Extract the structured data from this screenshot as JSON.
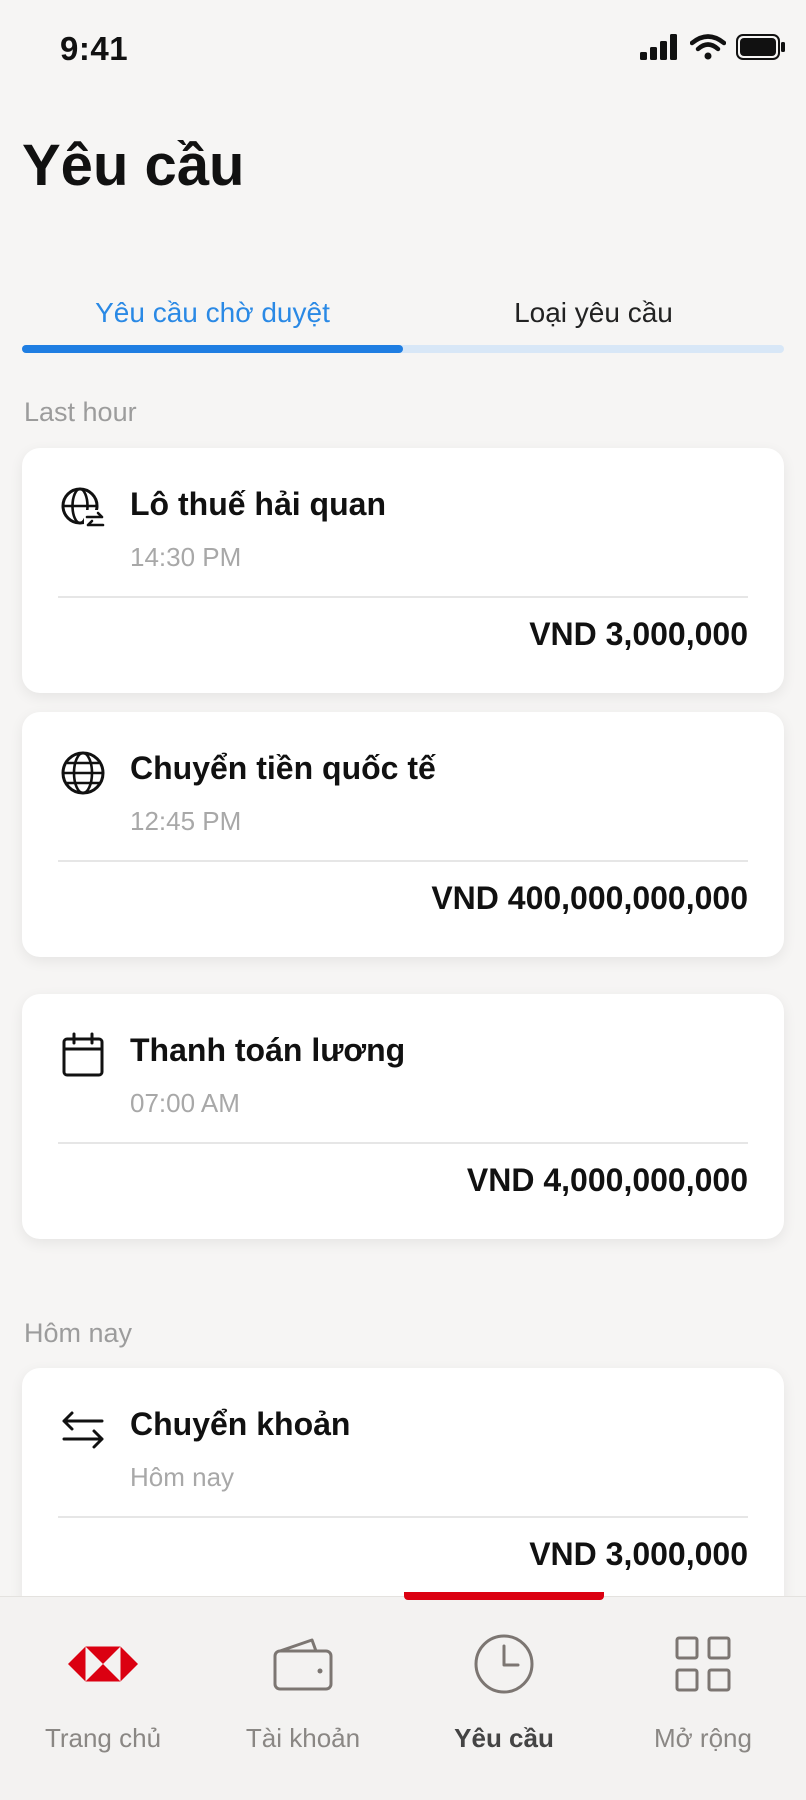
{
  "status_bar": {
    "time": "9:41"
  },
  "page": {
    "title": "Yêu cầu"
  },
  "tabs": [
    {
      "label": "Yêu cầu chờ duyệt",
      "active": true
    },
    {
      "label": "Loại yêu cầu",
      "active": false
    }
  ],
  "sections": [
    {
      "label": "Last hour",
      "items": [
        {
          "title": "Lô thuế hải quan",
          "time": "14:30 PM",
          "amount": "VND 3,000,000",
          "icon": "globe-exchange-icon"
        },
        {
          "title": "Chuyển tiền quốc tế",
          "time": "12:45 PM",
          "amount": "VND 400,000,000,000",
          "icon": "globe-icon"
        },
        {
          "title": "Thanh toán lương",
          "time": "07:00 AM",
          "amount": "VND 4,000,000,000",
          "icon": "calendar-icon"
        }
      ]
    },
    {
      "label": "Hôm nay",
      "items": [
        {
          "title": "Chuyển khoản",
          "time": "Hôm nay",
          "amount": "VND 3,000,000",
          "icon": "transfer-arrows-icon"
        }
      ]
    }
  ],
  "bottom_nav": [
    {
      "label": "Trang chủ",
      "icon": "bank-logo-icon",
      "active": false
    },
    {
      "label": "Tài khoản",
      "icon": "wallet-icon",
      "active": false
    },
    {
      "label": "Yêu cầu",
      "icon": "clock-icon",
      "active": true
    },
    {
      "label": "Mở rộng",
      "icon": "grid-icon",
      "active": false
    }
  ],
  "colors": {
    "accent_blue": "#1f7ee2",
    "brand_red": "#db0011",
    "background": "#f6f5f4"
  }
}
